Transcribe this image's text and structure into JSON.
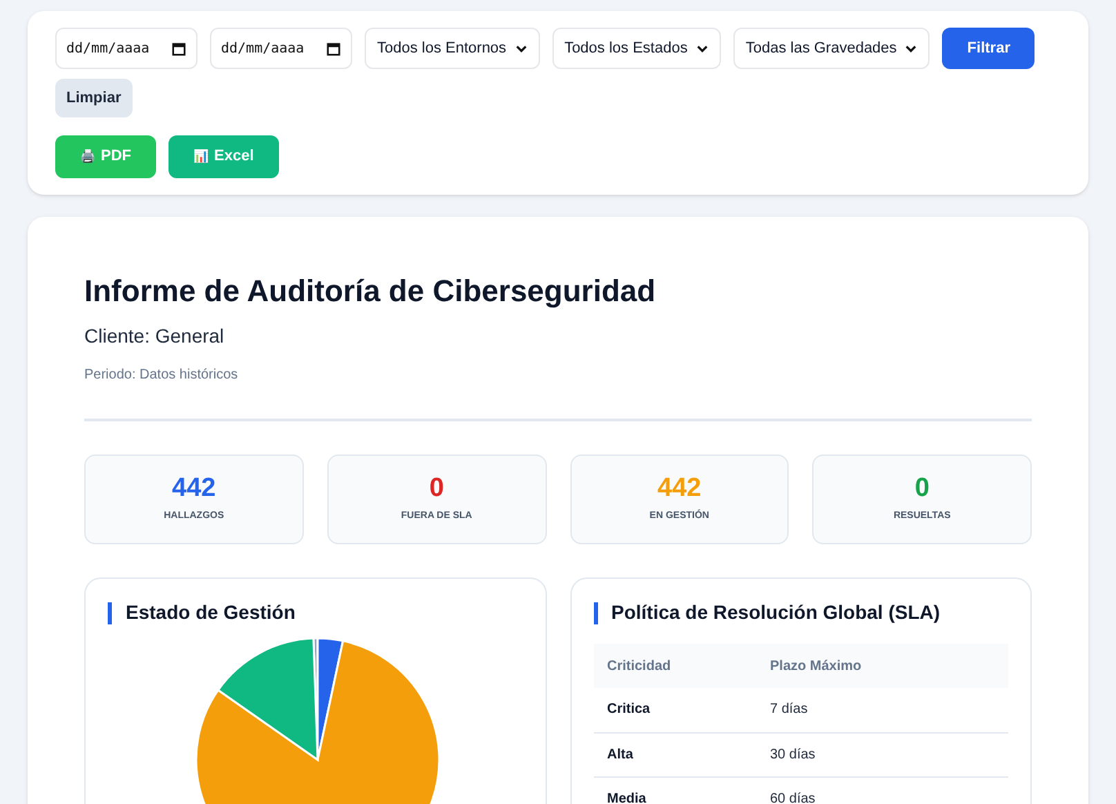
{
  "filters": {
    "date_from": {
      "placeholder": "dd/mm/aaaa"
    },
    "date_to": {
      "placeholder": "dd/mm/aaaa"
    },
    "selects": [
      {
        "value": "Todos los Entornos"
      },
      {
        "value": "Todos los Estados"
      },
      {
        "value": "Todas las Gravedades"
      }
    ],
    "buttons": [
      {
        "label": "Filtrar",
        "kind": "primary"
      },
      {
        "label": "Limpiar",
        "kind": "secondary"
      }
    ]
  },
  "exports": [
    {
      "label": "PDF",
      "icon": "🖨️",
      "kind": "pdf"
    },
    {
      "label": "Excel",
      "icon": "📊",
      "kind": "excel"
    }
  ],
  "report": {
    "title": "Informe de Auditoría de Ciberseguridad",
    "client": "Cliente: General",
    "period": "Periodo: Datos históricos",
    "stats": [
      {
        "value": "442",
        "label": "HALLAZGOS",
        "color": "#2563eb"
      },
      {
        "value": "0",
        "label": "FUERA DE SLA",
        "color": "#dc2626"
      },
      {
        "value": "442",
        "label": "EN GESTIÓN",
        "color": "#f59e0b"
      },
      {
        "value": "0",
        "label": "RESUELTAS",
        "color": "#16a34a"
      }
    ],
    "status_panel": {
      "title": "Estado de Gestión"
    },
    "sla_panel": {
      "title": "Política de Resolución Global (SLA)",
      "columns": [
        "Criticidad",
        "Plazo Máximo"
      ],
      "rows": [
        [
          "Critica",
          "7 días"
        ],
        [
          "Alta",
          "30 días"
        ],
        [
          "Media",
          "60 días"
        ]
      ]
    }
  }
}
